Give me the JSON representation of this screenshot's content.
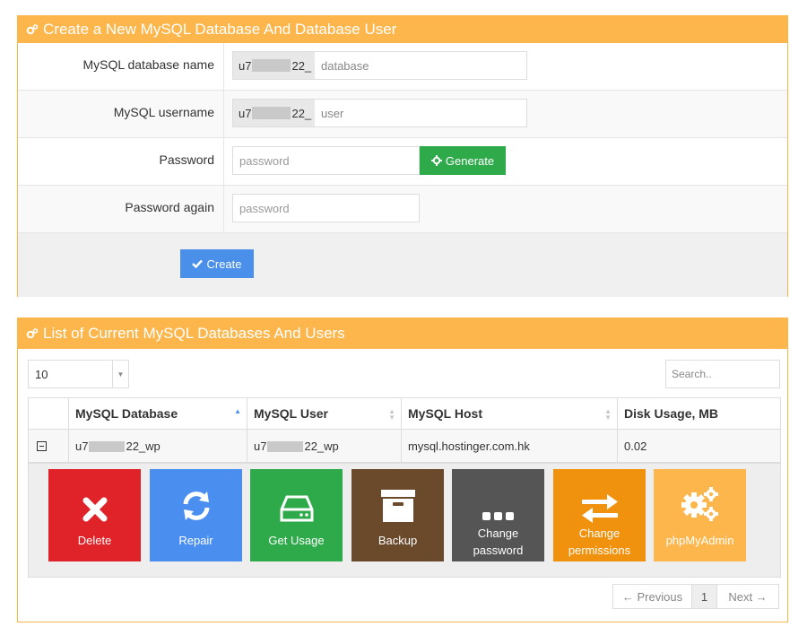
{
  "create_panel": {
    "title": "Create a New MySQL Database And Database User",
    "db_name": {
      "label": "MySQL database name",
      "prefix_start": "u7",
      "prefix_end": "22_",
      "placeholder": "database"
    },
    "username": {
      "label": "MySQL username",
      "prefix_start": "u7",
      "prefix_end": "22_",
      "placeholder": "user"
    },
    "password": {
      "label": "Password",
      "placeholder": "password",
      "generate_label": "Generate"
    },
    "password_again": {
      "label": "Password again",
      "placeholder": "password"
    },
    "create_label": "Create"
  },
  "list_panel": {
    "title": "List of Current MySQL Databases And Users",
    "page_size": "10",
    "search_placeholder": "Search..",
    "columns": [
      "MySQL Database",
      "MySQL User",
      "MySQL Host",
      "Disk Usage, MB"
    ],
    "rows": [
      {
        "db_start": "u7",
        "db_end": "22_wp",
        "user_start": "u7",
        "user_end": "22_wp",
        "host": "mysql.hostinger.com.hk",
        "usage": "0.02"
      }
    ],
    "actions": [
      {
        "label": "Delete",
        "color": "#e02329"
      },
      {
        "label": "Repair",
        "color": "#4a8ff0"
      },
      {
        "label": "Get Usage",
        "color": "#2eaa4b"
      },
      {
        "label": "Backup",
        "color": "#6b4a2b"
      },
      {
        "label": "Change password",
        "color": "#555555"
      },
      {
        "label": "Change permissions",
        "color": "#f0920d"
      },
      {
        "label": "phpMyAdmin",
        "color": "#fdb64b"
      }
    ],
    "pagination": {
      "prev": "← Previous",
      "page": "1",
      "next": "Next →"
    }
  }
}
